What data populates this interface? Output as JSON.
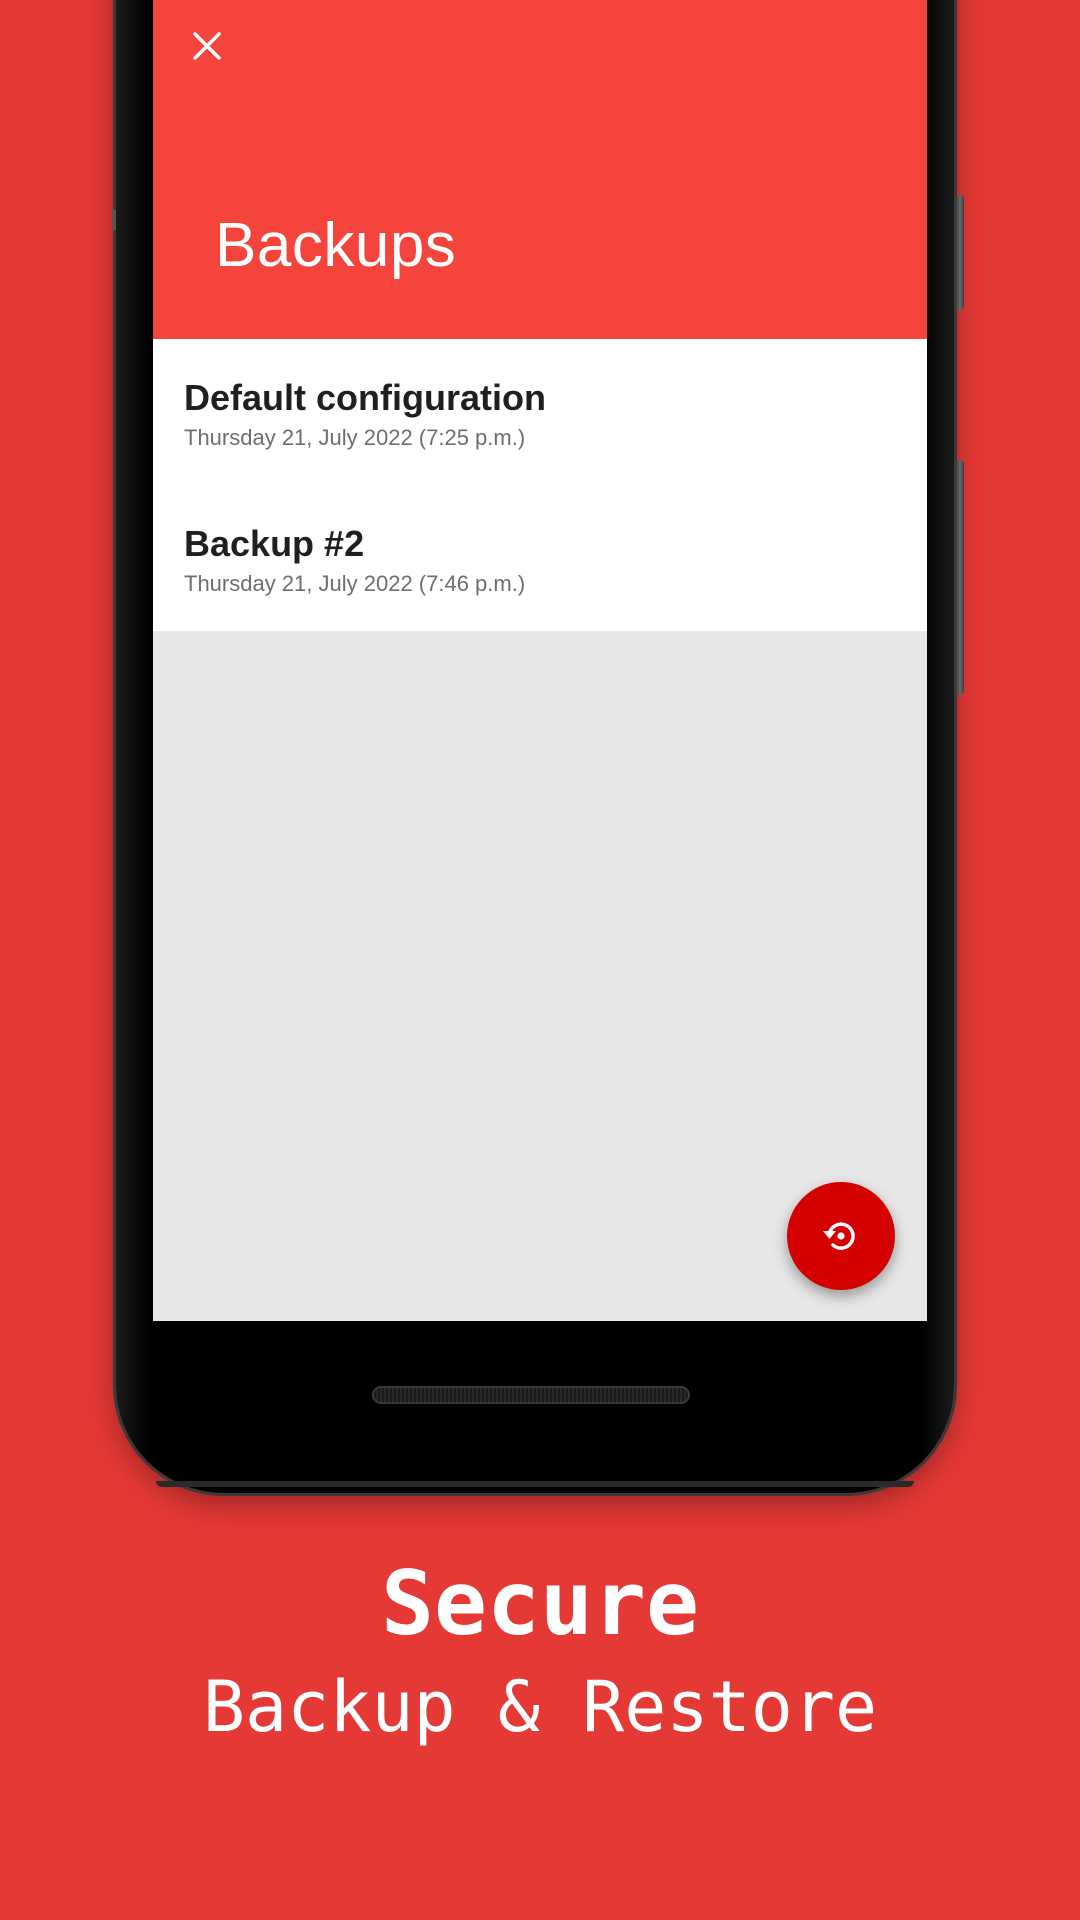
{
  "colors": {
    "background": "#e53935",
    "appbar": "#f5443b",
    "fab": "#d50000",
    "list_background": "#ffffff",
    "screen_background": "#e7e7e7"
  },
  "appbar": {
    "close_icon": "close-icon",
    "title": "Backups"
  },
  "backups": [
    {
      "title": "Default configuration",
      "date": "Thursday 21, July 2022 (7:25 p.m.)"
    },
    {
      "title": "Backup #2",
      "date": "Thursday 21, July 2022 (7:46 p.m.)"
    }
  ],
  "fab": {
    "icon": "restore-icon"
  },
  "caption": {
    "title": "Secure",
    "subtitle": "Backup & Restore"
  }
}
